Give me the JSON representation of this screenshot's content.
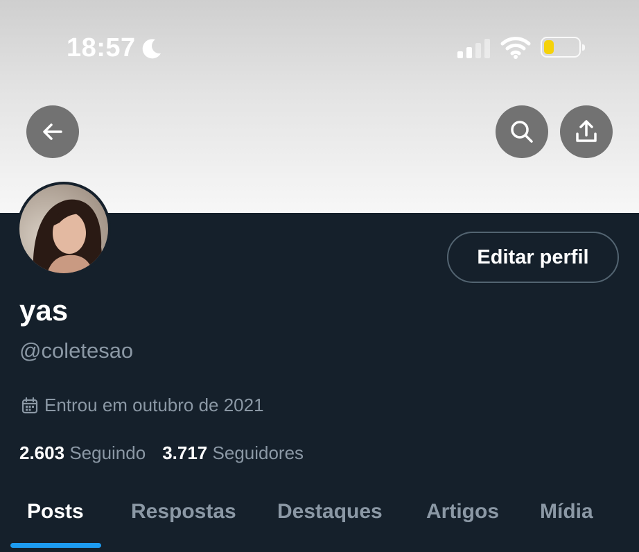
{
  "status_bar": {
    "time": "18:57",
    "dnd_icon": "moon-icon",
    "signal_icon": "cellular-signal-icon",
    "wifi_icon": "wifi-icon",
    "battery_icon": "battery-icon",
    "battery_color": "#f5d20a"
  },
  "header": {
    "back_icon": "arrow-left-icon",
    "search_icon": "search-icon",
    "share_icon": "share-upload-icon"
  },
  "profile": {
    "display_name": "yas",
    "handle": "@coletesao",
    "joined_icon": "calendar-icon",
    "joined_text": "Entrou em outubro de 2021",
    "edit_button": "Editar perfil",
    "following_count": "2.603",
    "following_label": "Seguindo",
    "followers_count": "3.717",
    "followers_label": "Seguidores"
  },
  "tabs": [
    {
      "label": "Posts",
      "active": true
    },
    {
      "label": "Respostas",
      "active": false
    },
    {
      "label": "Destaques",
      "active": false
    },
    {
      "label": "Artigos",
      "active": false
    },
    {
      "label": "Mídia",
      "active": false
    }
  ],
  "colors": {
    "background": "#15202b",
    "accent": "#1d9bf0",
    "secondary_text": "#8b98a5"
  }
}
